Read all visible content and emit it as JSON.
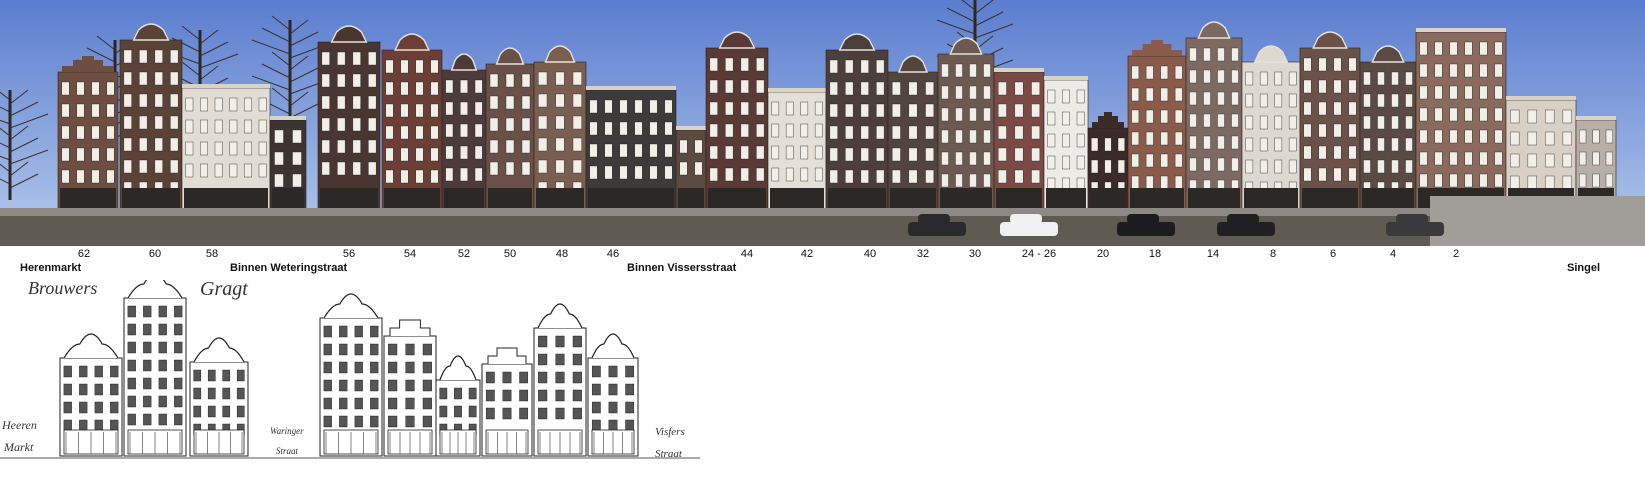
{
  "house_numbers": [
    "62",
    "60",
    "58",
    "56",
    "54",
    "52",
    "50",
    "48",
    "46",
    "44",
    "42",
    "40",
    "32",
    "30",
    "24 - 26",
    "20",
    "18",
    "14",
    "8",
    "6",
    "4",
    "2"
  ],
  "streets": [
    "Herenmarkt",
    "Binnen Weteringstraat",
    "Binnen Vissersstraat",
    "Singel"
  ],
  "engraving": {
    "title_word1": "Brouwers",
    "title_word2": "Gragt",
    "left_label_line1": "Heeren",
    "left_label_line2": "Markt",
    "middle_label_line1": "Waringer",
    "middle_label_line2": "Straat",
    "right_label_line1": "Visfers",
    "right_label_line2": "Straat"
  },
  "colors": {
    "sky": "#6f8fd8",
    "brick_dark": "#4a3630",
    "brick_red": "#7a4a3e",
    "stone_light": "#e4dfd6",
    "canal_wall": "#5b5650",
    "ink": "#222222"
  }
}
